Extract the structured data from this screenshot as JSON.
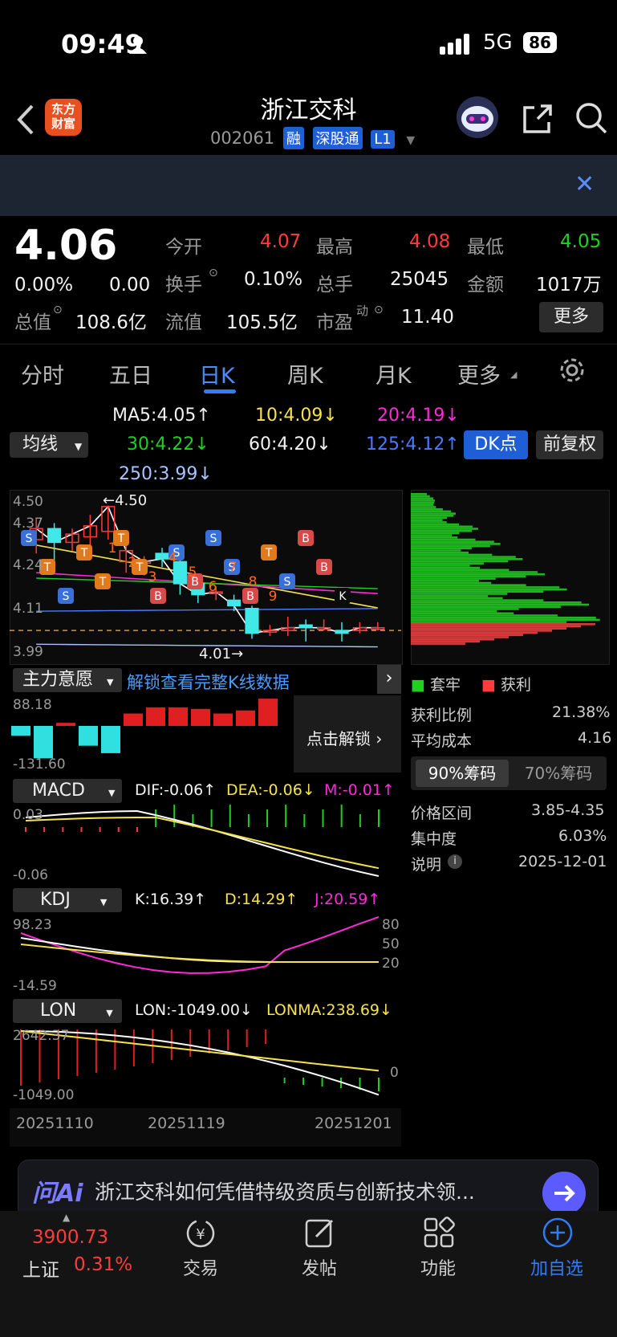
{
  "status": {
    "time": "09:49",
    "network": "5G",
    "battery": "86"
  },
  "header": {
    "back_icon": "chevron-left-icon",
    "logo_line1": "东方",
    "logo_line2": "财富",
    "stock_name": "浙江交科",
    "stock_code": "002061",
    "tags": [
      "融",
      "深股通",
      "L1"
    ]
  },
  "quote": {
    "price": "4.06",
    "change_pct": "0.00%",
    "change": "0.00",
    "open_label": "今开",
    "open": "4.07",
    "high_label": "最高",
    "high": "4.08",
    "low_label": "最低",
    "low": "4.05",
    "turnover_label": "换手",
    "turnover": "0.10%",
    "volume_label": "总手",
    "volume": "25045",
    "amount_label": "金额",
    "amount": "1017万",
    "mktcap_label": "总值",
    "mktcap": "108.6亿",
    "float_label": "流值",
    "float": "105.5亿",
    "pe_label": "市盈",
    "pe_sup": "动",
    "pe": "11.40",
    "more_button": "更多"
  },
  "tabs": [
    "分时",
    "五日",
    "日K",
    "周K",
    "月K",
    "更多"
  ],
  "active_tab": "日K",
  "ma": {
    "selector": "均线",
    "ma5": "MA5:4.05↑",
    "ma10": "10:4.09↓",
    "ma20": "20:4.19↓",
    "ma30": "30:4.22↓",
    "ma60": "60:4.20↓",
    "ma125": "125:4.12↑",
    "ma250": "250:3.99↓",
    "dk_button": "DK点",
    "adj_button": "前复权"
  },
  "kline": {
    "y_labels": [
      "4.50",
      "4.37",
      "4.24",
      "4.11",
      "3.99"
    ],
    "high_marker": "←4.50",
    "low_marker": "4.01→",
    "candles": [
      {
        "o": 4.38,
        "c": 4.42,
        "h": 4.46,
        "l": 4.33
      },
      {
        "o": 4.42,
        "c": 4.37,
        "h": 4.44,
        "l": 4.3
      },
      {
        "o": 4.37,
        "c": 4.4,
        "h": 4.42,
        "l": 4.34
      },
      {
        "o": 4.39,
        "c": 4.43,
        "h": 4.47,
        "l": 4.36
      },
      {
        "o": 4.41,
        "c": 4.5,
        "h": 4.5,
        "l": 4.38
      },
      {
        "o": 4.3,
        "c": 4.34,
        "h": 4.4,
        "l": 4.26
      },
      {
        "o": 4.3,
        "c": 4.3,
        "h": 4.32,
        "l": 4.25
      },
      {
        "o": 4.33,
        "c": 4.31,
        "h": 4.35,
        "l": 4.28
      },
      {
        "o": 4.3,
        "c": 4.22,
        "h": 4.32,
        "l": 4.18
      },
      {
        "o": 4.22,
        "c": 4.18,
        "h": 4.25,
        "l": 4.15
      },
      {
        "o": 4.19,
        "c": 4.19,
        "h": 4.21,
        "l": 4.16
      },
      {
        "o": 4.16,
        "c": 4.14,
        "h": 4.18,
        "l": 4.12
      },
      {
        "o": 4.13,
        "c": 4.04,
        "h": 4.14,
        "l": 4.02
      },
      {
        "o": 4.05,
        "c": 4.05,
        "h": 4.07,
        "l": 4.03
      },
      {
        "o": 4.05,
        "c": 4.06,
        "h": 4.1,
        "l": 4.03
      },
      {
        "o": 4.07,
        "c": 4.06,
        "h": 4.09,
        "l": 4.01
      },
      {
        "o": 4.06,
        "c": 4.06,
        "h": 4.09,
        "l": 4.05
      },
      {
        "o": 4.05,
        "c": 4.04,
        "h": 4.08,
        "l": 4.01
      },
      {
        "o": 4.05,
        "c": 4.06,
        "h": 4.08,
        "l": 4.04
      },
      {
        "o": 4.06,
        "c": 4.06,
        "h": 4.08,
        "l": 4.05
      }
    ],
    "overlay_numbers": [
      "1",
      "2",
      "3",
      "4",
      "5",
      "6",
      "7",
      "8",
      "9"
    ],
    "signals": [
      "S",
      "T",
      "S",
      "T",
      "T",
      "T",
      "T",
      "B",
      "S",
      "B",
      "S",
      "S",
      "B",
      "T",
      "S",
      "B",
      "B",
      "K"
    ]
  },
  "main_force": {
    "selector": "主力意愿",
    "unlock_text": "解锁查看完整K线数据",
    "max": "88.18",
    "min": "-131.60",
    "unlock_button": "点击解锁",
    "bars": [
      -40,
      -131,
      10,
      -80,
      -110,
      40,
      60,
      60,
      55,
      40,
      50,
      88
    ]
  },
  "macd": {
    "selector": "MACD",
    "dif": "DIF:-0.06↑",
    "dea": "DEA:-0.06↓",
    "m": "M:-0.01↑",
    "max": "0.03",
    "min": "-0.06"
  },
  "kdj": {
    "selector": "KDJ",
    "k": "K:16.39↑",
    "d": "D:14.29↑",
    "j": "J:20.59↑",
    "max": "98.23",
    "min": "-14.59",
    "levels": [
      "80",
      "50",
      "20"
    ]
  },
  "lon": {
    "selector": "LON",
    "lon": "LON:-1049.00↓",
    "lonma": "LONMA:238.69↓",
    "max": "2642.37",
    "min": "-1049.00",
    "zero": "0"
  },
  "x_axis": [
    "20251110",
    "20251119",
    "20251201"
  ],
  "chips": {
    "legend_solid": "套牢",
    "legend_profit": "获利",
    "profit_ratio_label": "获利比例",
    "profit_ratio": "21.38%",
    "avg_cost_label": "平均成本",
    "avg_cost": "4.16",
    "tab_90": "90%筹码",
    "tab_70": "70%筹码",
    "range_label": "价格区间",
    "range": "3.85-4.35",
    "concentration_label": "集中度",
    "concentration": "6.03%",
    "note_label": "说明",
    "date": "2025-12-01"
  },
  "ai": {
    "logo": "问Ai",
    "text": "浙江交科如何凭借特级资质与创新技术领..."
  },
  "bottom_nav": {
    "index_value": "3900.73",
    "index_name": "上证",
    "index_change": "0.31%",
    "trade": "交易",
    "post": "发帖",
    "function": "功能",
    "watchlist": "加自选"
  },
  "colors": {
    "up": "#ff3b3b",
    "down": "#40e8e8",
    "accent": "#2f7df6"
  }
}
